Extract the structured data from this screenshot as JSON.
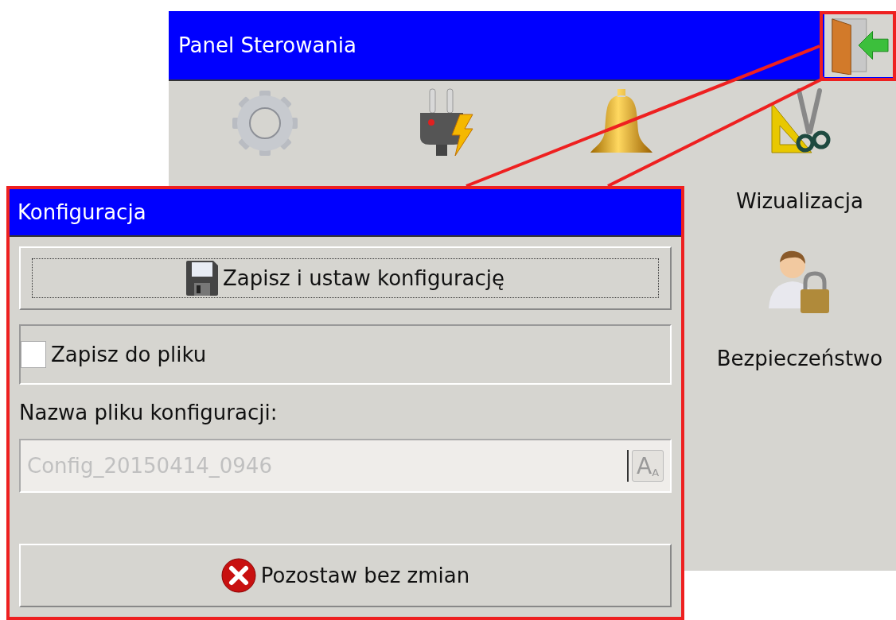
{
  "main_window": {
    "title": "Panel Sterowania",
    "exit_button": {
      "highlighted": true
    },
    "items": [
      {
        "kind": "gear"
      },
      {
        "kind": "plug"
      },
      {
        "kind": "bell"
      },
      {
        "kind": "tools",
        "label": "Wizualizacja"
      },
      {
        "kind": "user-lock",
        "label": "Bezpieczeństwo"
      }
    ]
  },
  "dialog": {
    "title": "Konfiguracja",
    "highlighted": true,
    "save_button": {
      "label": "Zapisz i ustaw konfigurację",
      "focused": true
    },
    "save_to_file": {
      "label": "Zapisz do pliku",
      "checked": false
    },
    "filename_label": "Nazwa pliku konfiguracji:",
    "filename_field": {
      "value": "Config_20150414_0946",
      "disabled": true
    },
    "font_button": {
      "large": "A",
      "small": "A"
    },
    "cancel_button": {
      "label": "Pozostaw bez zmian"
    }
  }
}
